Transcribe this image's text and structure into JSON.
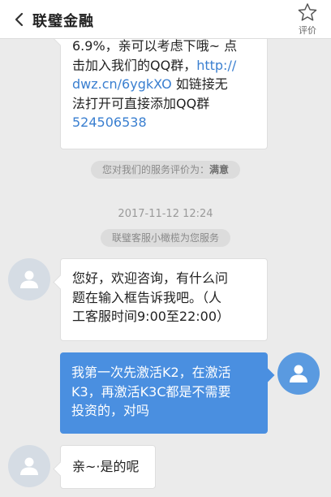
{
  "header": {
    "title": "联璧金融",
    "rate_label": "评价"
  },
  "messages": {
    "prev_agent": {
      "line1": "6.9%，亲可以考虑下哦~ 点",
      "line2_pre": "击加入我们的QQ群，",
      "line2_link": "http://",
      "line3_link": "dwz.cn/6ygkXO",
      "line3_post": " 如链接无",
      "line4": "法打开可直接添加QQ群",
      "line5_link": "524506538"
    },
    "rating_notice_pre": "您对我们的服务评价为：",
    "rating_value": "满意",
    "timestamp": "2017-11-12 12:24",
    "service_notice": "联璧客服小橄榄为您服务",
    "agent_greeting": {
      "line1": "您好，欢迎咨询，有什么问",
      "line2": "题在输入框告诉我吧。（人",
      "line3": "工客服时间9:00至22:00）"
    },
    "user_question": {
      "line1": "我第一次先激活K2，在激活",
      "line2": "K3，再激活K3C都是不需要",
      "line3": "投资的，对吗"
    },
    "agent_reply": "亲~·是的呢"
  },
  "colors": {
    "accent": "#4a8fe0",
    "link": "#3a7fd0"
  }
}
